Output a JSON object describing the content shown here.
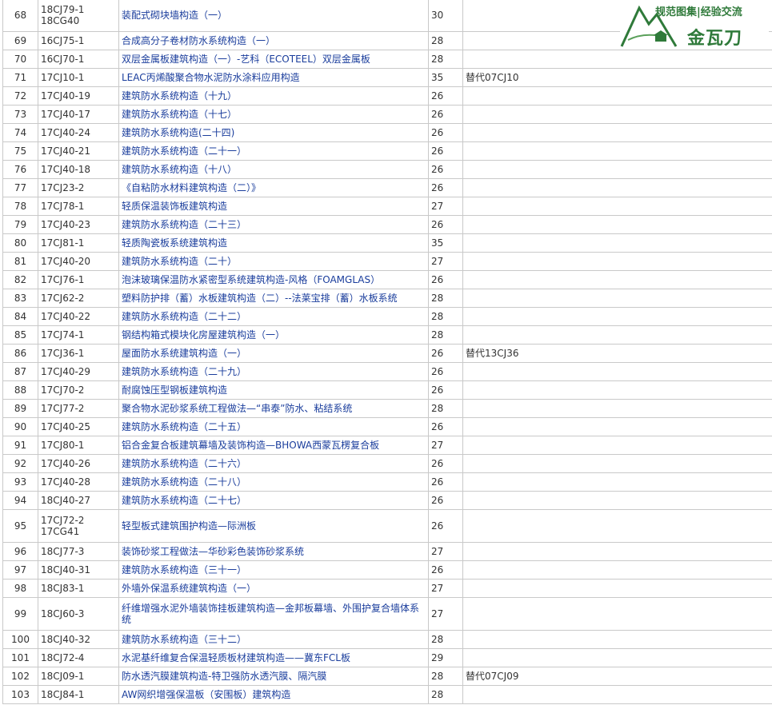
{
  "logo": {
    "slogan": "规范图集|经验交流",
    "name": "金瓦刀"
  },
  "rows": [
    {
      "no": "68",
      "code": "18CJ79-1\n18CG40",
      "name": "装配式砌块墙构造（一）",
      "pages": "30",
      "note": ""
    },
    {
      "no": "69",
      "code": "16CJ75-1",
      "name": "合成高分子卷材防水系统构造（一）",
      "pages": "28",
      "note": ""
    },
    {
      "no": "70",
      "code": "16CJ70-1",
      "name": "双层金属板建筑构造（一）-艺科（ECOTEEL）双层金属板",
      "pages": "28",
      "note": ""
    },
    {
      "no": "71",
      "code": "17CJ10-1",
      "name": "LEAC丙烯酸聚合物水泥防水涂料应用构造",
      "pages": "35",
      "note": "替代07CJ10"
    },
    {
      "no": "72",
      "code": "17CJ40-19",
      "name": "建筑防水系统构造（十九）",
      "pages": "26",
      "note": ""
    },
    {
      "no": "73",
      "code": "17CJ40-17",
      "name": "建筑防水系统构造（十七）",
      "pages": "26",
      "note": ""
    },
    {
      "no": "74",
      "code": "17CJ40-24",
      "name": "建筑防水系统构造(二十四)",
      "pages": "26",
      "note": ""
    },
    {
      "no": "75",
      "code": "17CJ40-21",
      "name": "建筑防水系统构造（二十一）",
      "pages": "26",
      "note": ""
    },
    {
      "no": "76",
      "code": "17CJ40-18",
      "name": "建筑防水系统构造（十八）",
      "pages": "26",
      "note": ""
    },
    {
      "no": "77",
      "code": "17CJ23-2",
      "name": "《自粘防水材料建筑构造（二）》",
      "pages": "26",
      "note": ""
    },
    {
      "no": "78",
      "code": "17CJ78-1",
      "name": "轻质保温装饰板建筑构造",
      "pages": "27",
      "note": ""
    },
    {
      "no": "79",
      "code": "17CJ40-23",
      "name": "建筑防水系统构造（二十三）",
      "pages": "26",
      "note": ""
    },
    {
      "no": "80",
      "code": "17CJ81-1",
      "name": "轻质陶瓷板系统建筑构造",
      "pages": "35",
      "note": ""
    },
    {
      "no": "81",
      "code": "17CJ40-20",
      "name": "建筑防水系统构造（二十）",
      "pages": "27",
      "note": ""
    },
    {
      "no": "82",
      "code": "17CJ76-1",
      "name": "泡沫玻璃保温防水紧密型系统建筑构造-风格（FOAMGLAS）",
      "pages": "26",
      "note": ""
    },
    {
      "no": "83",
      "code": "17CJ62-2",
      "name": "塑料防护排（蓄）水板建筑构造（二）--法莱宝排（蓄）水板系统",
      "pages": "28",
      "note": ""
    },
    {
      "no": "84",
      "code": "17CJ40-22",
      "name": "建筑防水系统构造（二十二）",
      "pages": "28",
      "note": ""
    },
    {
      "no": "85",
      "code": "17CJ74-1",
      "name": "钢结构箱式模块化房屋建筑构造（一）",
      "pages": "28",
      "note": ""
    },
    {
      "no": "86",
      "code": "17CJ36-1",
      "name": "屋面防水系统建筑构造（一）",
      "pages": "26",
      "note": "替代13CJ36"
    },
    {
      "no": "87",
      "code": "17CJ40-29",
      "name": "建筑防水系统构造（二十九）",
      "pages": "26",
      "note": ""
    },
    {
      "no": "88",
      "code": "17CJ70-2",
      "name": "耐腐蚀压型钢板建筑构造",
      "pages": "26",
      "note": ""
    },
    {
      "no": "89",
      "code": "17CJ77-2",
      "name": "聚合物水泥砂浆系统工程做法—“串泰”防水、粘结系统",
      "pages": "28",
      "note": ""
    },
    {
      "no": "90",
      "code": "17CJ40-25",
      "name": "建筑防水系统构造（二十五）",
      "pages": "26",
      "note": ""
    },
    {
      "no": "91",
      "code": "17CJ80-1",
      "name": "铝合金复合板建筑幕墙及装饰构造—BHOWA西蒙瓦楞复合板",
      "pages": "27",
      "note": ""
    },
    {
      "no": "92",
      "code": "17CJ40-26",
      "name": "建筑防水系统构造（二十六）",
      "pages": "26",
      "note": ""
    },
    {
      "no": "93",
      "code": "17CJ40-28",
      "name": "建筑防水系统构造（二十八）",
      "pages": "26",
      "note": ""
    },
    {
      "no": "94",
      "code": "18CJ40-27",
      "name": "建筑防水系统构造（二十七）",
      "pages": "26",
      "note": ""
    },
    {
      "no": "95",
      "code": "17CJ72-2\n17CG41",
      "name": "轻型板式建筑围护构造—际洲板",
      "pages": "26",
      "note": ""
    },
    {
      "no": "96",
      "code": "18CJ77-3",
      "name": "装饰砂浆工程做法—华砂彩色装饰砂浆系统",
      "pages": "27",
      "note": ""
    },
    {
      "no": "97",
      "code": "18CJ40-31",
      "name": "建筑防水系统构造（三十一）",
      "pages": "26",
      "note": ""
    },
    {
      "no": "98",
      "code": "18CJ83-1",
      "name": "外墙外保温系统建筑构造（一）",
      "pages": "27",
      "note": ""
    },
    {
      "no": "99",
      "code": "18CJ60-3",
      "name": "纤维增强水泥外墙装饰挂板建筑构造—金邦板幕墙、外围护复合墙体系统",
      "pages": "27",
      "note": ""
    },
    {
      "no": "100",
      "code": "18CJ40-32",
      "name": "建筑防水系统构造（三十二）",
      "pages": "28",
      "note": ""
    },
    {
      "no": "101",
      "code": "18CJ72-4",
      "name": "水泥基纤维复合保温轻质板材建筑构造——冀东FCL板",
      "pages": "29",
      "note": ""
    },
    {
      "no": "102",
      "code": "18CJ09-1",
      "name": "防水透汽膜建筑构造-特卫强防水透汽膜、隔汽膜",
      "pages": "28",
      "note": "替代07CJ09"
    },
    {
      "no": "103",
      "code": "18CJ84-1",
      "name": "AW网织增强保温板（安围板）建筑构造",
      "pages": "28",
      "note": ""
    }
  ],
  "colors": {
    "link": "#1a3d9c",
    "text": "#333333",
    "border": "#c9c9c9",
    "logo": "#2f7a3a"
  }
}
